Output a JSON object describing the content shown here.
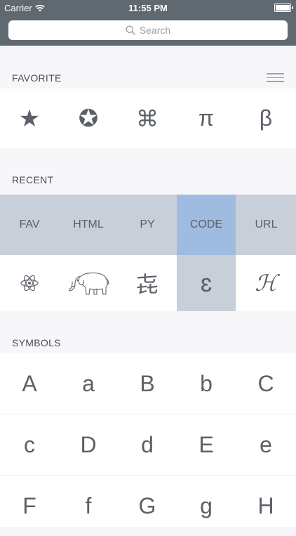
{
  "status": {
    "carrier": "Carrier",
    "time": "11:55 PM"
  },
  "search": {
    "placeholder": "Search"
  },
  "favorite": {
    "header": "FAVORITE",
    "symbols": [
      "★",
      "✪",
      "⌘",
      "π",
      "β"
    ]
  },
  "recent": {
    "header": "RECENT",
    "tabs": [
      "FAV",
      "HTML",
      "PY",
      "CODE",
      "URL"
    ],
    "active_tab": "CODE",
    "symbols": [
      "⚛",
      "",
      "㐂",
      "ɛ",
      "ℋ"
    ]
  },
  "symbols": {
    "header": "SYMBOLS",
    "rows": [
      [
        "A",
        "a",
        "B",
        "b",
        "C"
      ],
      [
        "c",
        "D",
        "d",
        "E",
        "e"
      ],
      [
        "F",
        "f",
        "G",
        "g",
        "H"
      ]
    ]
  },
  "colors": {
    "topbar": "#606870",
    "tab_bg": "#c8cfd9",
    "tab_active": "#9fbbe0",
    "accent": "#8aa6d0"
  }
}
